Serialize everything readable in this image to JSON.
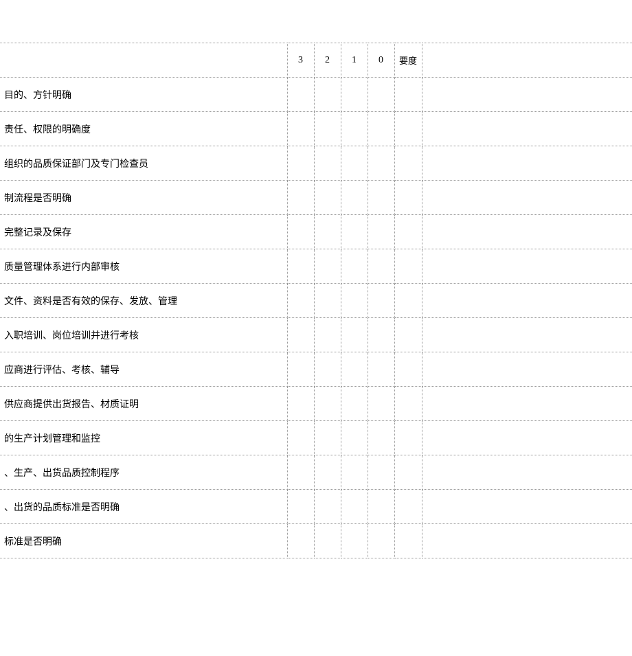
{
  "header": {
    "col3": "3",
    "col2": "2",
    "col1": "1",
    "col0": "0",
    "yaodu": "要度"
  },
  "rows": [
    {
      "desc": "目的、方针明确"
    },
    {
      "desc": "责任、权限的明确度"
    },
    {
      "desc": "组织的品质保证部门及专门检查员"
    },
    {
      "desc": "制流程是否明确"
    },
    {
      "desc": "完整记录及保存"
    },
    {
      "desc": "质量管理体系进行内部审核"
    },
    {
      "desc": "文件、资料是否有效的保存、发放、管理"
    },
    {
      "desc": "入职培训、岗位培训并进行考核"
    },
    {
      "desc": "应商进行评估、考核、辅导"
    },
    {
      "desc": "供应商提供出货报告、材质证明"
    },
    {
      "desc": "的生产计划管理和监控"
    },
    {
      "desc": "、生产、出货品质控制程序"
    },
    {
      "desc": "、出货的品质标准是否明确"
    },
    {
      "desc": "标准是否明确"
    }
  ]
}
